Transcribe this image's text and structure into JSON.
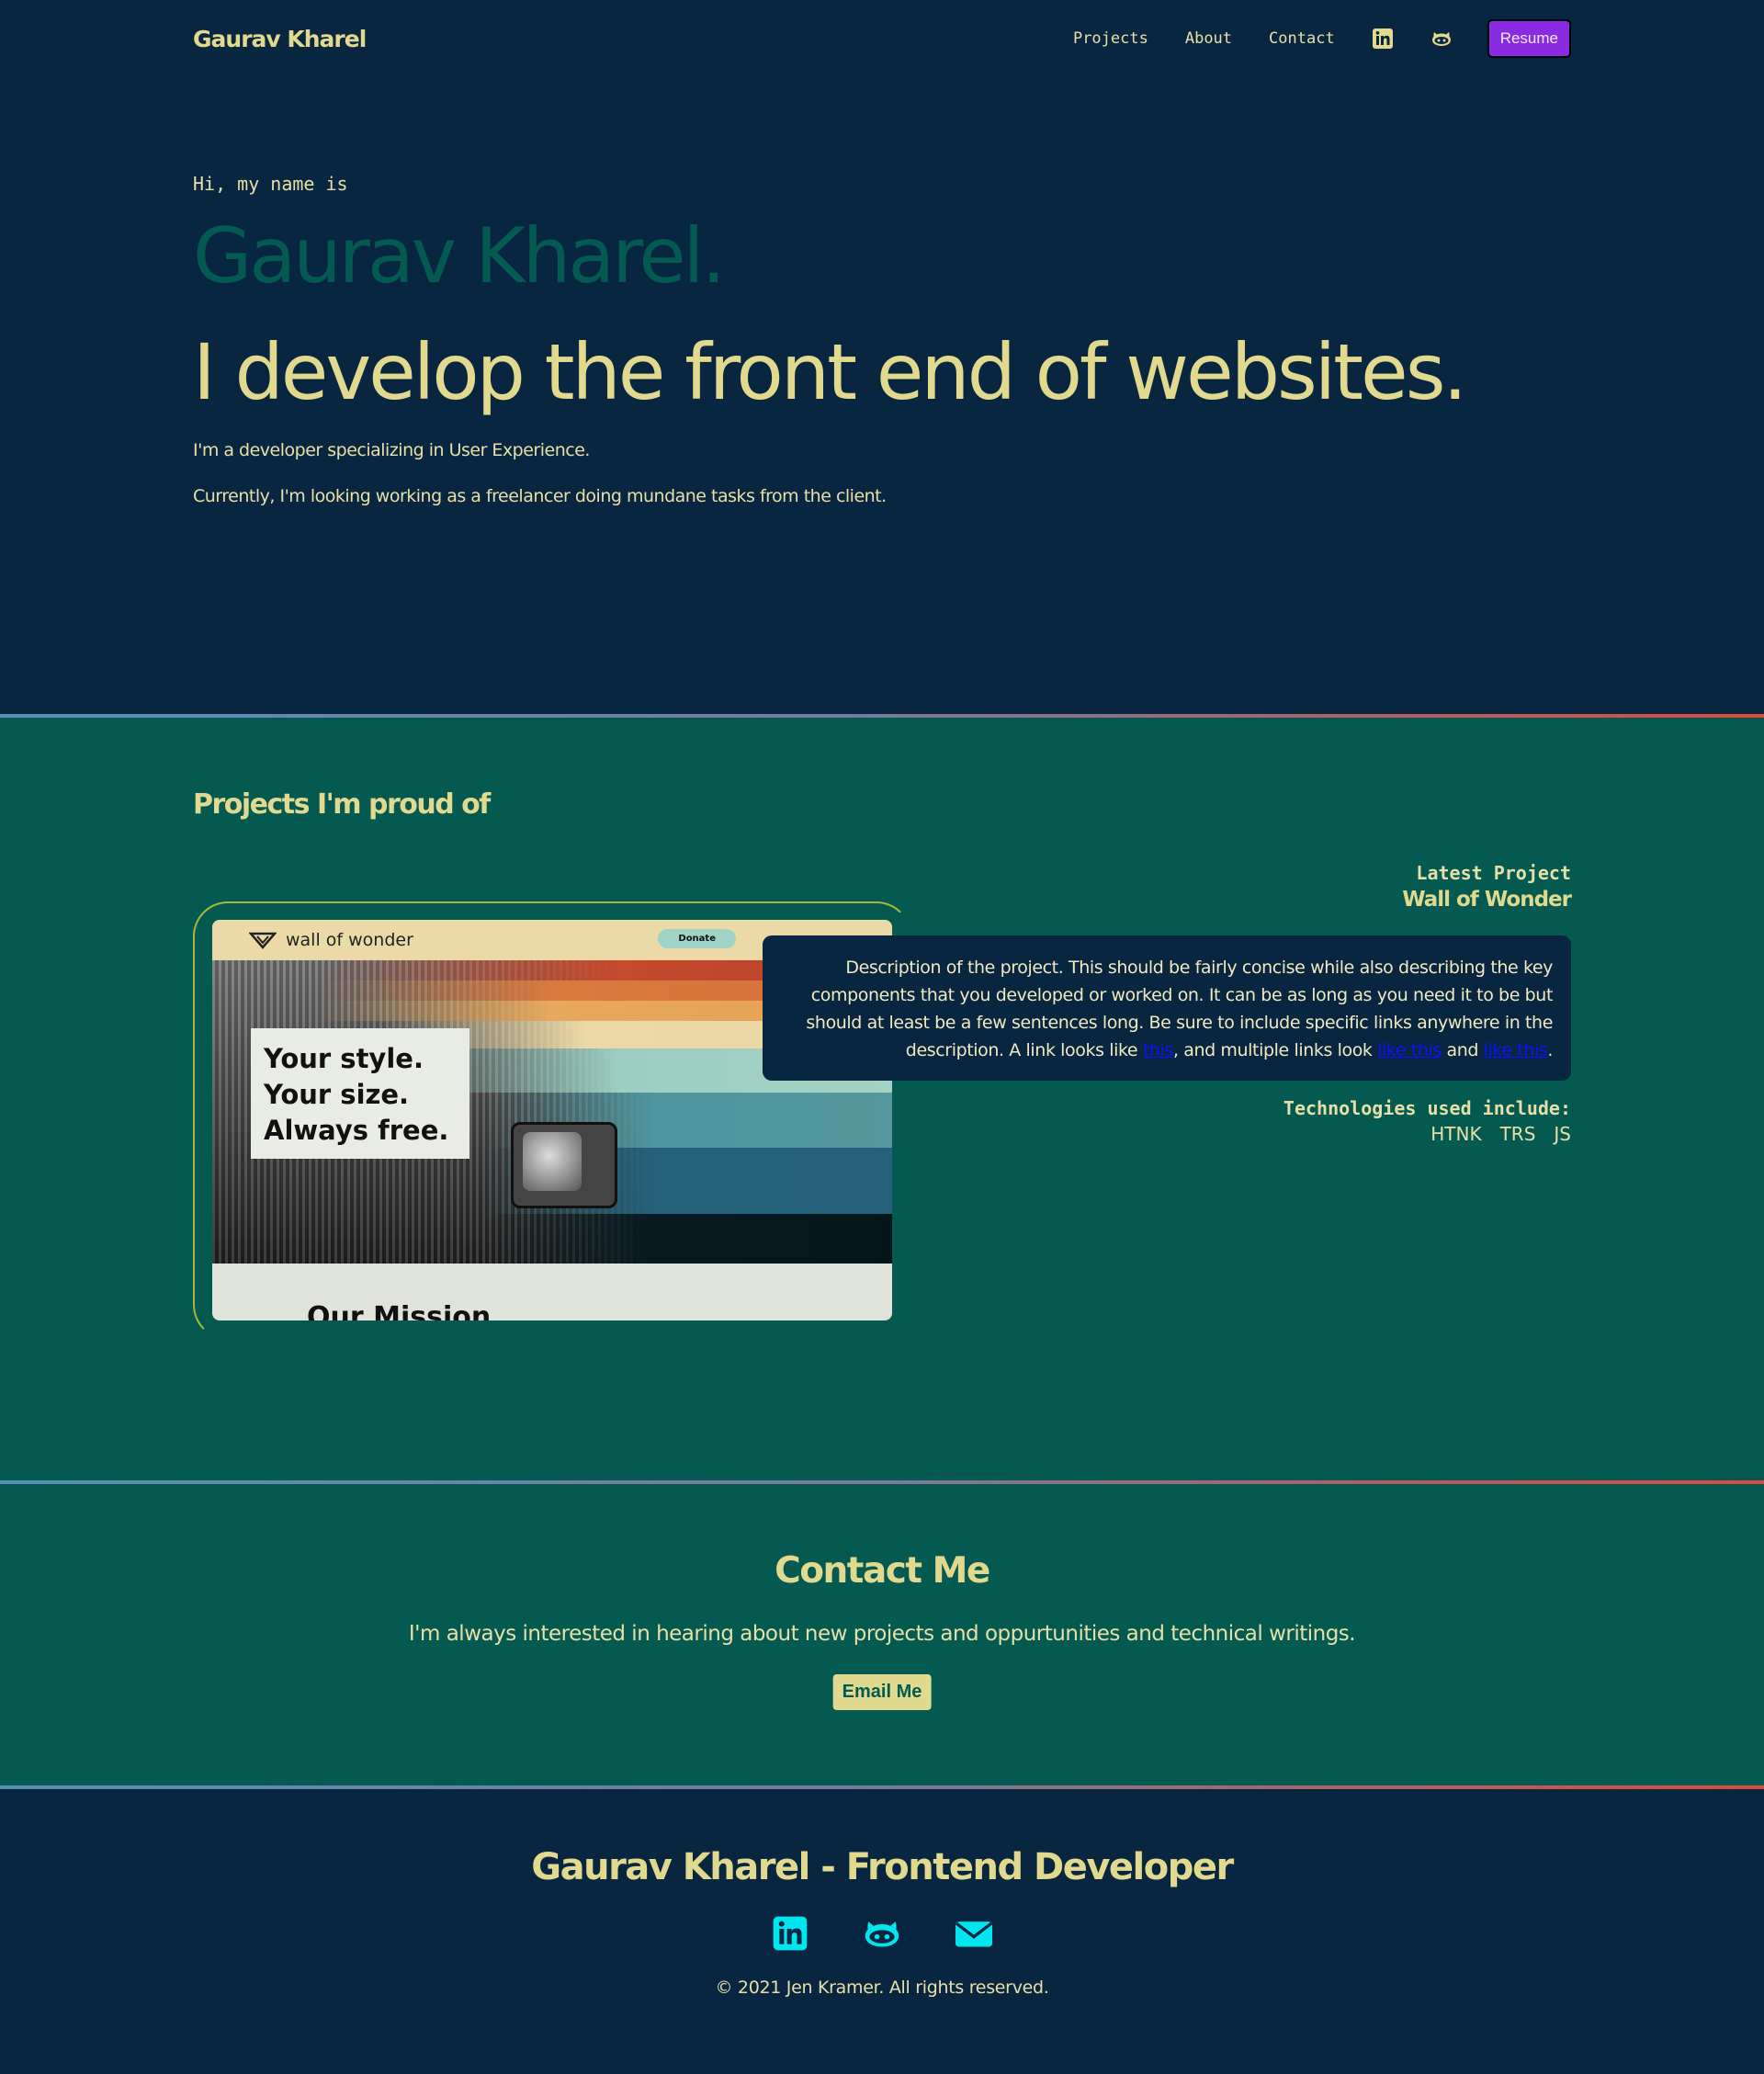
{
  "nav": {
    "brand": "Gaurav Kharel",
    "links": [
      "Projects",
      "About",
      "Contact"
    ],
    "icons": [
      "linkedin-icon",
      "github-icon"
    ],
    "resume_label": "Resume"
  },
  "hero": {
    "intro": "Hi, my name is",
    "name": "Gaurav Kharel.",
    "tagline": "I develop the front end of websites.",
    "p1": "I'm a developer specializing in User Experience.",
    "p2": "Currently, I'm looking working as a freelancer doing mundane tasks from the client."
  },
  "projects": {
    "title": "Projects I'm proud of",
    "latest_label": "Latest Project",
    "name": "Wall of Wonder",
    "screenshot": {
      "logo_text": "wall of wonder",
      "donate": "Donate",
      "headline": "Your style.\nYour size.\nAlways free.",
      "section": "Our Mission"
    },
    "description": {
      "before": "Description of the project. This should be fairly concise while also describing the key components that you developed or worked on. It can be as long as you need it to be but should at least be a few sentences long. Be sure to include specific links anywhere in the description. A link looks like ",
      "link1": "this",
      "middle": ", and multiple links look ",
      "link2": "like this",
      "and": " and ",
      "link3": "like this",
      "end": "."
    },
    "tech_label": "Technologies used include:",
    "tech": [
      "HTNK",
      "TRS",
      "JS"
    ]
  },
  "contact": {
    "title": "Contact Me",
    "text": "I'm always interested in hearing about new projects and oppurtunities and technical writings.",
    "button": "Email Me"
  },
  "footer": {
    "title": "Gaurav Kharel - Frontend Developer",
    "icons": [
      "linkedin-icon",
      "github-icon",
      "mail-icon"
    ],
    "copyright": "© 2021 Jen Kramer. All rights reserved."
  },
  "colors": {
    "navy": "#082640",
    "teal": "#045a51",
    "yellow": "#e0d98e",
    "purple": "#8a2be2",
    "cyan": "#00e5ee"
  }
}
